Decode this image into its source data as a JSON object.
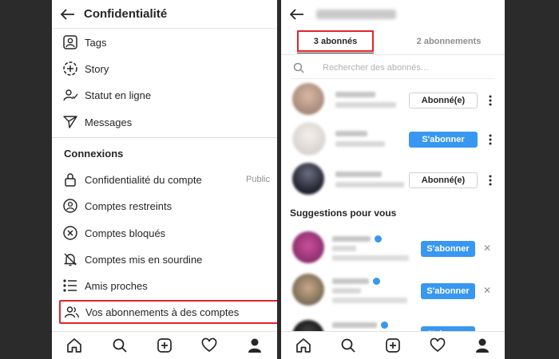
{
  "left": {
    "title": "Confidentialité",
    "items_top": [
      {
        "label": "Tags",
        "icon": "tag-person-icon"
      },
      {
        "label": "Story",
        "icon": "story-add-icon"
      },
      {
        "label": "Statut en ligne",
        "icon": "online-status-icon"
      },
      {
        "label": "Messages",
        "icon": "paper-plane-icon"
      }
    ],
    "section": "Connexions",
    "items_conn": [
      {
        "label": "Confidentialité du compte",
        "extra": "Public",
        "icon": "lock-icon"
      },
      {
        "label": "Comptes restreints",
        "icon": "restricted-icon"
      },
      {
        "label": "Comptes bloqués",
        "icon": "blocked-icon"
      },
      {
        "label": "Comptes mis en sourdine",
        "icon": "muted-bell-icon"
      },
      {
        "label": "Amis proches",
        "icon": "close-friends-list-icon"
      }
    ],
    "highlighted_item": {
      "label": "Vos abonnements à des comptes",
      "icon": "following-people-icon"
    }
  },
  "right": {
    "tabs": [
      "3 abonnés",
      "2 abonnements"
    ],
    "search_placeholder": "Rechercher des abonnés...",
    "followers": [
      {
        "button": "Abonné(e)",
        "style": "outline"
      },
      {
        "button": "S'abonner",
        "style": "filled"
      },
      {
        "button": "Abonné(e)",
        "style": "outline"
      }
    ],
    "suggestions_title": "Suggestions pour vous",
    "suggestions": [
      {
        "button": "S'abonner"
      },
      {
        "button": "S'abonner"
      },
      {
        "button": "S'abonner"
      }
    ]
  },
  "nav_icons": [
    "home-icon",
    "search-icon",
    "new-post-icon",
    "activity-heart-icon",
    "profile-icon"
  ],
  "colors": {
    "accent": "#3897f0",
    "highlight": "#e0242d",
    "text": "#262626",
    "muted": "#8e8e8e"
  }
}
